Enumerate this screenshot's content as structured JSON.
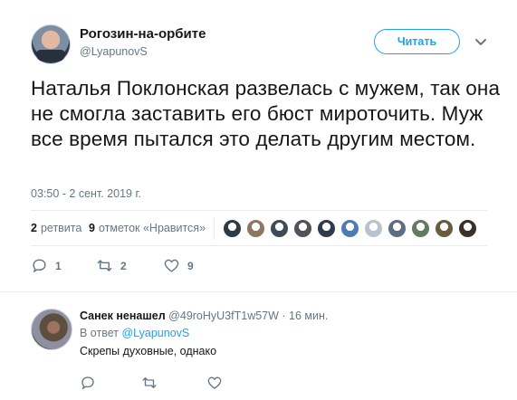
{
  "tweet": {
    "author_name": "Рогозин-на-орбите",
    "author_handle": "@LyapunovS",
    "follow_label": "Читать",
    "text": "Наталья Поклонская развелась с мужем, так она не смогла заставить его бюст мироточить. Муж все время пытался это делать другим местом.",
    "timestamp": "03:50 - 2 сент. 2019 г.",
    "retweets_count": "2",
    "retweets_label": "ретвита",
    "likes_count": "9",
    "likes_label": "отметок «Нравится»",
    "liker_avatar_colors": [
      "#2f3a43",
      "#8f7660",
      "#3f4b57",
      "#50545a",
      "#2d3b4c",
      "#4f7bb5",
      "#b9c3cf",
      "#5c6d86",
      "#617c5e",
      "#6a5c3f",
      "#3a3128"
    ],
    "actions": {
      "reply_count": "1",
      "retweet_count": "2",
      "like_count": "9"
    }
  },
  "reply": {
    "author_name": "Санек ненашел",
    "author_handle": "@49roHyU3fT1w57W",
    "time": "· 16 мин.",
    "in_reply_prefix": "В ответ",
    "in_reply_handle": "@LyapunovS",
    "text": "Скрепы духовные, однако"
  },
  "colors": {
    "accent": "#1da1f2",
    "muted": "#657786",
    "border": "#e6ecf0"
  }
}
